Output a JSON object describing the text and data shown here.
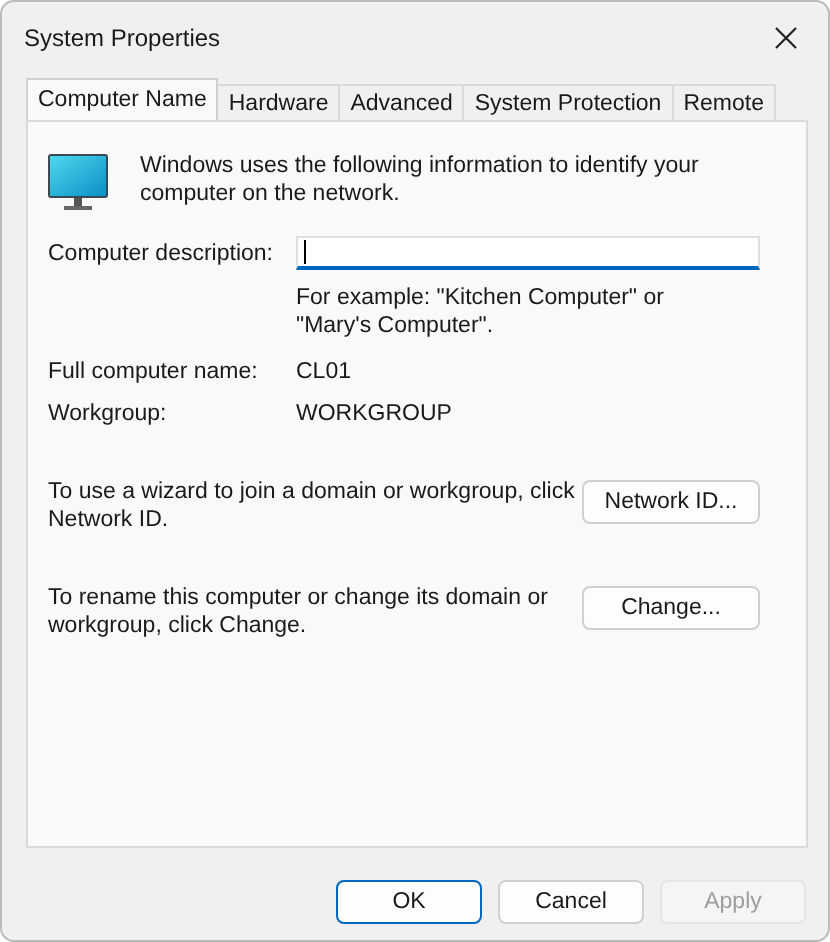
{
  "window": {
    "title": "System Properties"
  },
  "tabs": [
    {
      "label": "Computer Name",
      "selected": true
    },
    {
      "label": "Hardware",
      "selected": false
    },
    {
      "label": "Advanced",
      "selected": false
    },
    {
      "label": "System Protection",
      "selected": false
    },
    {
      "label": "Remote",
      "selected": false
    }
  ],
  "intro": "Windows uses the following information to identify your computer on the network.",
  "description": {
    "label": "Computer description:",
    "hint": "For example: \"Kitchen Computer\" or \"Mary's Computer\"."
  },
  "info": [
    {
      "label": "Full computer name:",
      "value": "CL01"
    },
    {
      "label": "Workgroup:",
      "value": "WORKGROUP"
    }
  ],
  "actions": [
    {
      "text": "To use a wizard to join a domain or workgroup, click Network ID.",
      "button": "Network ID..."
    },
    {
      "text": "To rename this computer or change its domain or workgroup, click Change.",
      "button": "Change..."
    }
  ],
  "buttons": [
    {
      "label": "OK",
      "default": true,
      "disabled": false
    },
    {
      "label": "Cancel",
      "default": false,
      "disabled": false
    },
    {
      "label": "Apply",
      "default": false,
      "disabled": true
    }
  ]
}
